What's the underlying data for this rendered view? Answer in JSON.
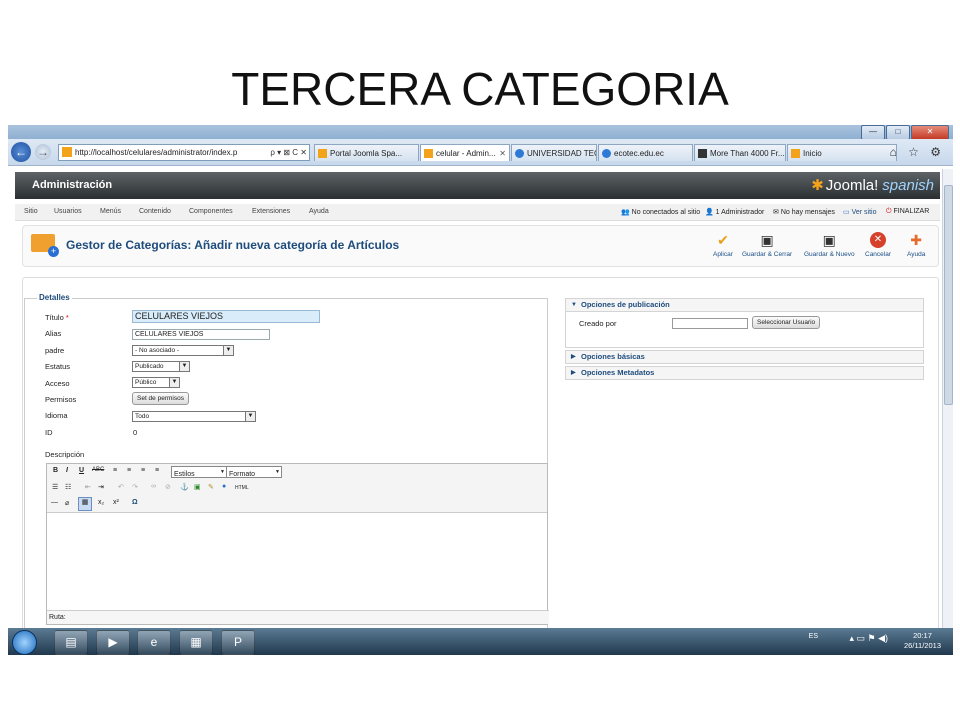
{
  "slide": {
    "title": "TERCERA CATEGORIA"
  },
  "browser": {
    "address": "http://localhost/celulares/administrator/index.p",
    "address_host_part": "localhost",
    "address_controls": "ρ ▾ ⊠ C ✕",
    "tabs": [
      {
        "label": "Portal Joomla Spa...",
        "active": false
      },
      {
        "label": "celular - Admin...",
        "active": true
      },
      {
        "label": "UNIVERSIDAD TEC...",
        "active": false
      },
      {
        "label": "ecotec.edu.ec",
        "active": false
      },
      {
        "label": "More Than 4000 Fr...",
        "active": false
      },
      {
        "label": "Inicio",
        "active": false
      }
    ],
    "tab_close": "✕",
    "window_buttons": {
      "minimize": "—",
      "maximize": "□",
      "close": "✕"
    },
    "right_icons": "⌂ ☆ ⚙"
  },
  "joomla": {
    "header": "Administración",
    "logo": "Joomla!",
    "logo_suffix": "spanish",
    "menu": [
      "Sitio",
      "Usuarios",
      "Menús",
      "Contenido",
      "Componentes",
      "Extensiones",
      "Ayuda"
    ],
    "status": {
      "not_connected": "No conectados al sitio",
      "admins": "1 Administrador",
      "messages": "No hay mensajes",
      "view_site": "Ver sitio",
      "logout": "FINALIZAR"
    },
    "page_title": "Gestor de Categorías: Añadir nueva categoría de Artículos",
    "toolbar": {
      "apply": "Aplicar",
      "save_close": "Guardar & Cerrar",
      "save_new": "Guardar & Nuevo",
      "cancel": "Cancelar",
      "help": "Ayuda"
    }
  },
  "form": {
    "legend": "Detalles",
    "title_label": "Título",
    "required_mark": "*",
    "title_value": "CELULARES VIEJOS",
    "alias_label": "Alias",
    "alias_value": "CELULARES VIEJOS",
    "parent_label": "padre",
    "parent_value": "- No asociado -",
    "status_label": "Estatus",
    "status_value": "Publicado",
    "access_label": "Acceso",
    "access_value": "Público",
    "permissions_label": "Permisos",
    "permissions_button": "Set de permisos",
    "language_label": "Idioma",
    "language_value": "Todo",
    "id_label": "ID",
    "id_value": "0",
    "description_label": "Descripción",
    "editor": {
      "styles": "Estilos",
      "format": "Formato",
      "path_label": "Ruta:"
    }
  },
  "right_panel": {
    "publishing": "Opciones de publicación",
    "created_by_label": "Creado por",
    "select_user_button": "Seleccionar Usuario",
    "basic_options": "Opciones básicas",
    "metadata_options": "Opciones Metadatos"
  },
  "taskbar": {
    "lang": "ES",
    "time": "20:17",
    "date": "26/11/2013"
  }
}
